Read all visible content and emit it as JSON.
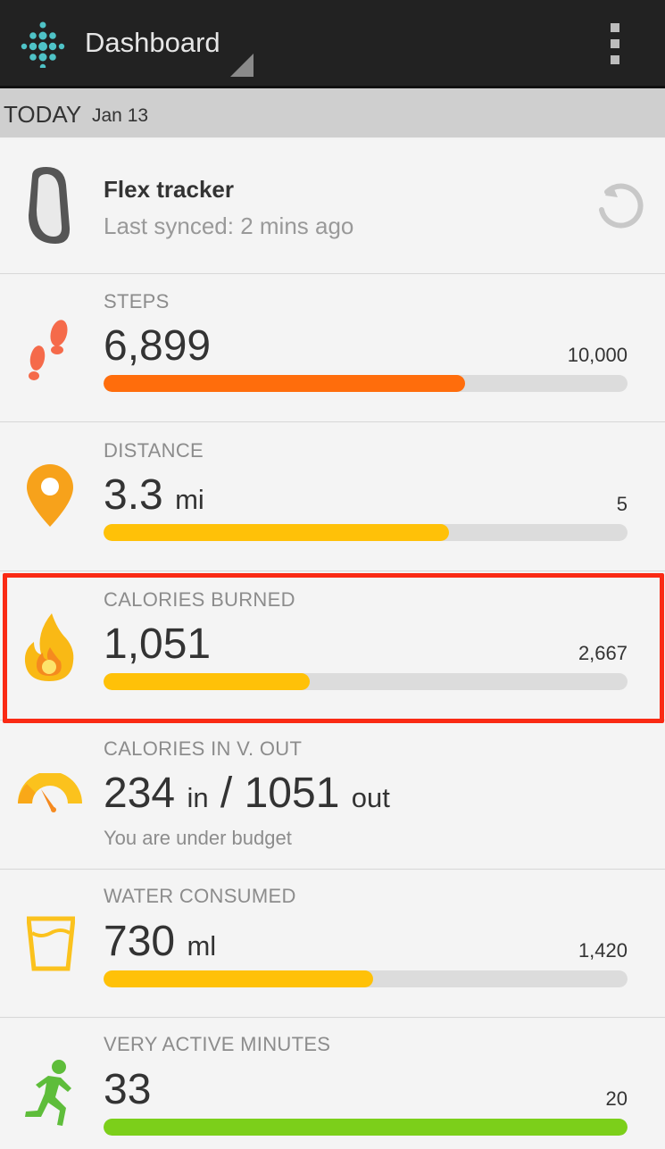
{
  "actionbar": {
    "title": "Dashboard",
    "logo_icon": "fitbit-logo-icon",
    "menu_icon": "overflow-menu-icon"
  },
  "date_header": {
    "label": "TODAY",
    "date": "Jan 13"
  },
  "tracker": {
    "name": "Flex tracker",
    "sync_status": "Last synced: 2 mins ago",
    "icon": "flex-band-icon",
    "sync_icon": "sync-icon"
  },
  "steps": {
    "label": "STEPS",
    "value": "6,899",
    "goal": "10,000",
    "progress": 0.69,
    "color": "#ff6d0c"
  },
  "distance": {
    "label": "DISTANCE",
    "value": "3.3",
    "unit": "mi",
    "goal": "5",
    "progress": 0.66,
    "color": "#ffc108"
  },
  "calories": {
    "label": "CALORIES BURNED",
    "value": "1,051",
    "goal": "2,667",
    "progress": 0.394,
    "color": "#ffc108"
  },
  "calories_in_out": {
    "label": "CALORIES IN V. OUT",
    "in_value": "234",
    "in_unit": "in",
    "separator": "/",
    "out_value": "1051",
    "out_unit": "out",
    "status": "You are under budget"
  },
  "water": {
    "label": "WATER CONSUMED",
    "value": "730",
    "unit": "ml",
    "goal": "1,420",
    "progress": 0.514,
    "color": "#ffc108"
  },
  "active_minutes": {
    "label": "VERY ACTIVE MINUTES",
    "value": "33",
    "goal": "20",
    "progress": 1.0,
    "color": "#7ccf1a"
  },
  "colors": {
    "highlight": "#fa2a14",
    "actionbar": "#222222"
  }
}
